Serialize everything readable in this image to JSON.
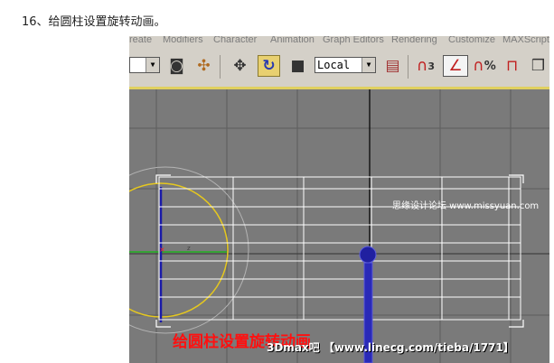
{
  "article": {
    "step_text": "16、给圆柱设置旋转动画。"
  },
  "menubar": {
    "items": [
      "reate",
      "Modifiers",
      "Character",
      "Animation",
      "Graph Editors",
      "Rendering",
      "Customize",
      "MAXScript"
    ]
  },
  "toolbar": {
    "coord_system": "Local",
    "snap_label": "3",
    "percent_label": "%",
    "icons": [
      "dropdown-arrow",
      "select-region",
      "select-link",
      "move",
      "rotate",
      "scale",
      "coord-dropdown",
      "pivot",
      "snap-3d",
      "angle-snap",
      "percent-snap",
      "spinner-snap",
      "teapot"
    ]
  },
  "viewport": {
    "grid_color": "#5c5c5c",
    "background": "#7a7a7a",
    "circle_color": "#e6c81e",
    "axis_blue": "#1a1aa8",
    "watermark": "思缘设计论坛 www.missyuan.com",
    "caption_cn": "给圆柱设置旋转动画",
    "caption_site": "3Dmax吧 【www.linecg.com/tieba/1771】"
  }
}
